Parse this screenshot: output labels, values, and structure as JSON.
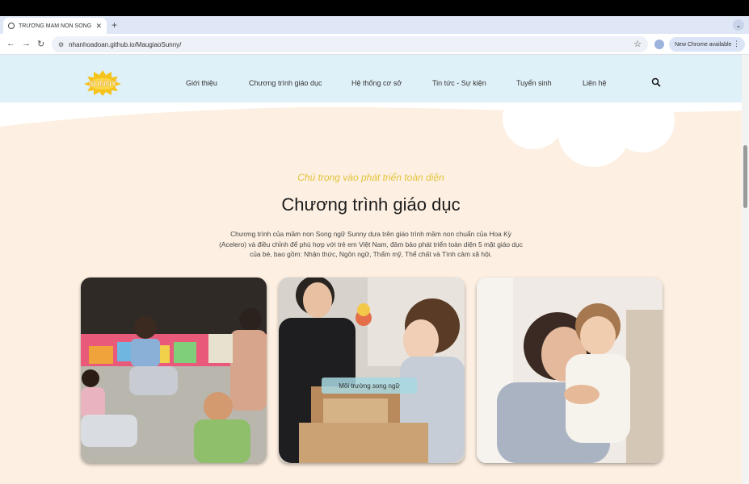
{
  "browser": {
    "tab_title": "TRƯỜNG MẦM NON SONG NGỮ SUNNY",
    "url": "nhanhoadoan.github.io/MaugiaoSunny/",
    "update_label": "New Chrome available"
  },
  "site": {
    "logo_text": "SUNNY",
    "nav": [
      {
        "label": "Giới thiệu"
      },
      {
        "label": "Chương trình giáo dục"
      },
      {
        "label": "Hệ thống cơ sở"
      },
      {
        "label": "Tin tức - Sự kiện"
      },
      {
        "label": "Tuyển sinh"
      },
      {
        "label": "Liên hệ"
      }
    ]
  },
  "section": {
    "tagline": "Chú trọng vào phát triển toàn diện",
    "title": "Chương trình giáo dục",
    "description": "Chương trình của mầm non Song ngữ Sunny dựa trên giáo trình mầm non chuẩn của Hoa Kỳ (Acelero) và điều chỉnh để phù hợp với trẻ em Việt Nam, đảm bảo phát triển toàn diện 5 mặt giáo dục của bé, bao gồm: Nhận thức, Ngôn ngữ, Thẩm mỹ, Thể chất và Tình cảm xã hội."
  },
  "cards": [
    {
      "label": ""
    },
    {
      "label": "Môi trường song ngữ"
    },
    {
      "label": ""
    }
  ],
  "colors": {
    "header_bg": "#dff1f8",
    "page_bg": "#fdf0e2",
    "tagline": "#e2c33a",
    "logo": "#f6c21c"
  }
}
